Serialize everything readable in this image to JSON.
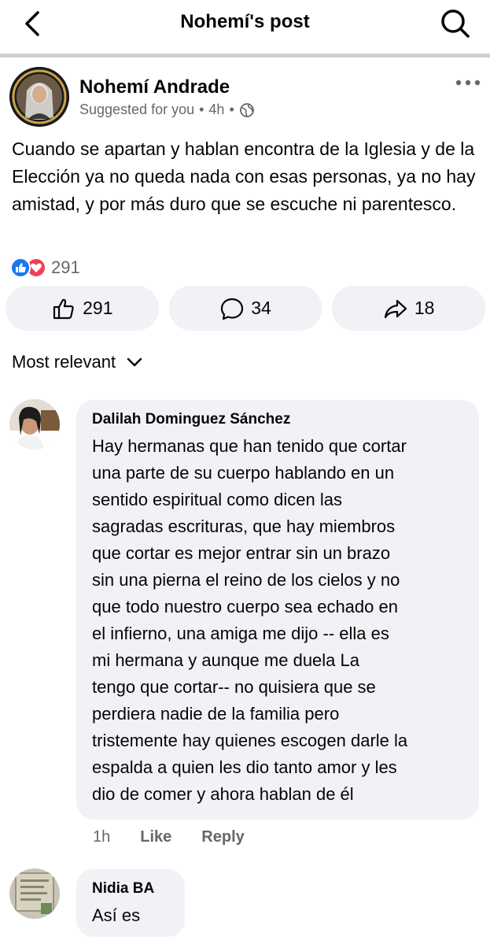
{
  "header": {
    "title": "Nohemí's post"
  },
  "post": {
    "author": "Nohemí Andrade",
    "suggested": "Suggested for you",
    "time": "4h",
    "dot": "•",
    "text": "Cuando se apartan y hablan encontra de la Iglesia y de la Elección ya no queda nada con esas personas, ya no hay amistad, y por más duro que se escuche ni parentesco.",
    "reaction_count": "291"
  },
  "actions": {
    "like_count": "291",
    "comment_count": "34",
    "share_count": "18"
  },
  "sort": {
    "label": "Most relevant"
  },
  "comments": [
    {
      "name": "Dalilah Dominguez Sánchez",
      "text": "Hay hermanas que han tenido que cortar\nuna parte de su cuerpo hablando en un\nsentido espiritual como dicen las\nsagradas escrituras, que hay miembros\nque cortar es mejor entrar sin un brazo\nsin una pierna el reino de los cielos y no\nque todo nuestro cuerpo sea echado en\nel infierno, una amiga me dijo -- ella es\nmi hermana y aunque me duela La\ntengo que cortar-- no quisiera que se\nperdiera nadie de la familia pero\ntristemente hay quienes escogen darle la\nespalda a quien les dio tanto amor y les\ndio de comer y ahora hablan de él",
      "time": "1h",
      "like": "Like",
      "reply": "Reply"
    },
    {
      "name": "Nidia BA",
      "text": "Así es"
    }
  ],
  "colors": {
    "accent": "#1877f2",
    "love": "#f33e58",
    "muted": "#65676b",
    "bubble": "#f0f2f5",
    "divider": "#ced0d4"
  }
}
